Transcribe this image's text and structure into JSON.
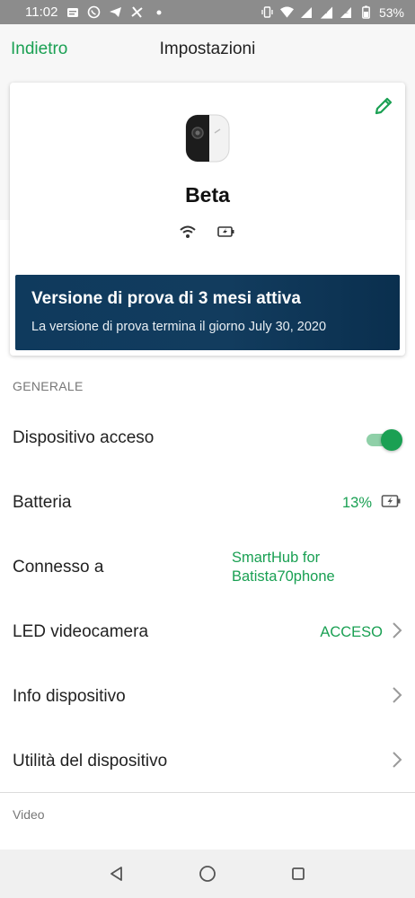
{
  "status_bar": {
    "time": "11:02",
    "battery_percent": "53%",
    "icons_left": [
      "message-icon",
      "whatsapp-icon",
      "telegram-icon",
      "fan-icon",
      "dot-icon"
    ],
    "icons_right": [
      "vibrate-icon",
      "wifi-icon",
      "signal-icon",
      "volte-icon",
      "signal2-icon",
      "battery-icon"
    ]
  },
  "app_bar": {
    "back_label": "Indietro",
    "title": "Impostazioni"
  },
  "device": {
    "name": "Beta",
    "trial_title": "Versione di prova di 3 mesi attiva",
    "trial_subtitle": "La versione di prova termina il giorno July 30, 2020"
  },
  "section": {
    "general_header": "GENERALE"
  },
  "rows": {
    "power": {
      "label": "Dispositivo acceso",
      "on": true
    },
    "battery": {
      "label": "Batteria",
      "value": "13%"
    },
    "connected": {
      "label": "Connesso a",
      "value": "SmartHub for Batista70phone"
    },
    "led": {
      "label": "LED videocamera",
      "value": "ACCESO"
    },
    "info": {
      "label": "Info dispositivo"
    },
    "utility": {
      "label": "Utilità del dispositivo"
    }
  },
  "video_section": {
    "label": "Video"
  },
  "colors": {
    "accent": "#1aa053",
    "banner": "#123c5e",
    "status_bar": "#8c8c8c"
  }
}
